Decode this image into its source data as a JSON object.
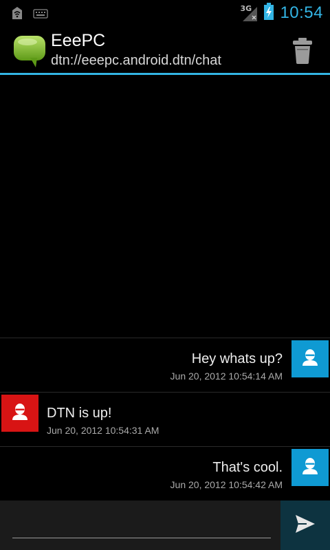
{
  "status_bar": {
    "network_label": "3G",
    "time": "10:54",
    "icons": [
      "wifi-notification-icon",
      "keyboard-icon",
      "signal-icon",
      "battery-charging-icon"
    ]
  },
  "action_bar": {
    "title": "EeePC",
    "subtitle": "dtn://eeepc.android.dtn/chat",
    "app_icon": "speech-bubble-icon",
    "action_icon": "trash-icon"
  },
  "messages": [
    {
      "direction": "out",
      "text": "Hey whats up?",
      "time": "Jun 20, 2012 10:54:14 AM",
      "avatar_color": "#0f9ad3"
    },
    {
      "direction": "in",
      "text": "DTN is up!",
      "time": "Jun 20, 2012 10:54:31 AM",
      "avatar_color": "#d81414"
    },
    {
      "direction": "out",
      "text": "That's cool.",
      "time": "Jun 20, 2012 10:54:42 AM",
      "avatar_color": "#0f9ad3"
    }
  ],
  "composer": {
    "value": "",
    "placeholder": "",
    "send_icon": "send-icon"
  },
  "colors": {
    "accent": "#33b5e5",
    "background": "#000000"
  }
}
